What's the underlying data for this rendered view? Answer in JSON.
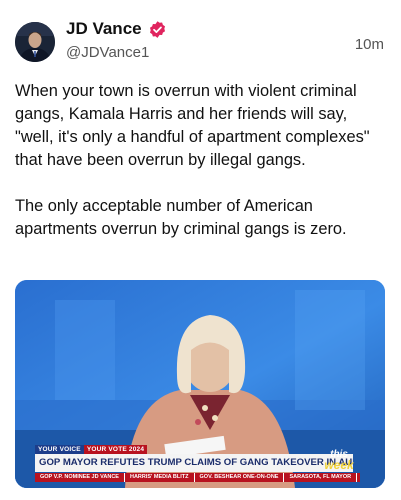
{
  "post": {
    "author": {
      "display_name": "JD Vance",
      "handle": "@JDVance1",
      "verified_badge_icon": "verified-badge-icon"
    },
    "timestamp": "10m",
    "paragraphs": [
      "When your town is overrun with violent criminal gangs, Kamala Harris and her friends will say, \"well, it's only a handful of apartment complexes\" that have been overrun by illegal gangs.",
      "The only acceptable number of American apartments overrun by criminal gangs is zero."
    ]
  },
  "media": {
    "chyron_tag_left": "YOUR VOICE",
    "chyron_tag_right": "YOUR VOTE 2024",
    "headline": "GOP MAYOR REFUTES TRUMP CLAIMS OF GANG TAKEOVER IN AURORA",
    "logo_line1": "this",
    "logo_line2": "week",
    "ticker": [
      "GOP V.P. NOMINEE JD VANCE",
      "HARRIS' MEDIA BLITZ",
      "GOV. BESHEAR ONE-ON-ONE",
      "SARASOTA, FL MAYOR"
    ]
  },
  "colors": {
    "verified": "#e0245e",
    "chyron_blue": "#1d3d8a",
    "ticker_red": "#b8121f"
  }
}
